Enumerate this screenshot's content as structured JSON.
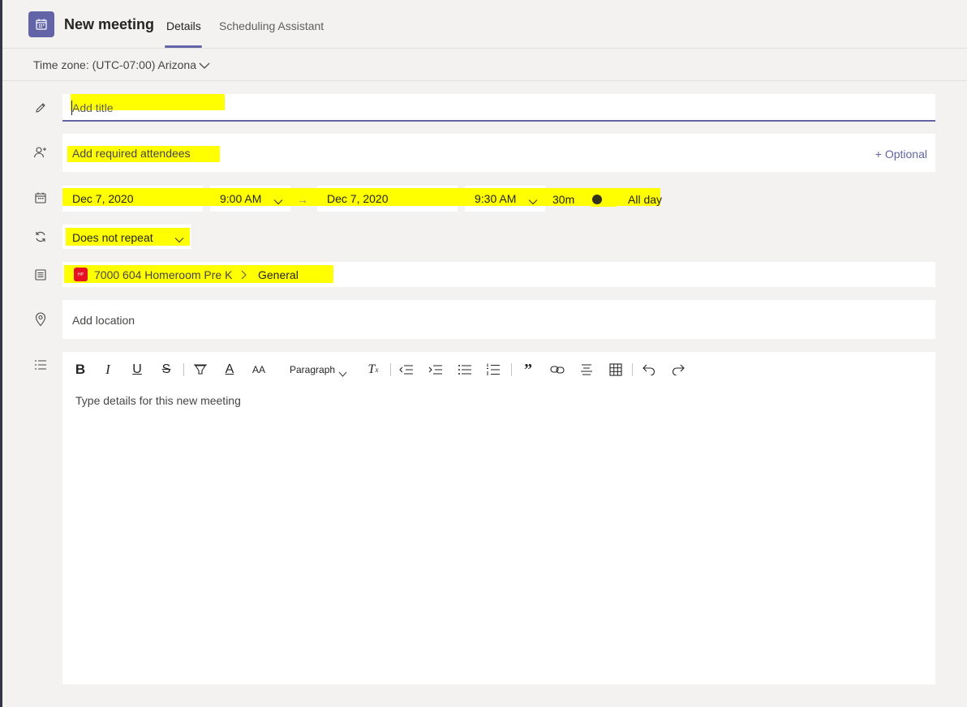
{
  "header": {
    "title": "New meeting",
    "tabs": [
      {
        "label": "Details",
        "active": true
      },
      {
        "label": "Scheduling Assistant",
        "active": false
      }
    ],
    "icon": "calendar-icon",
    "accent": "#6264a7"
  },
  "timezone": {
    "label": "Time zone: (UTC-07:00) Arizona"
  },
  "form": {
    "title_placeholder": "Add title",
    "attendees_placeholder": "Add required attendees",
    "optional_label": "+ Optional",
    "start_date": "Dec 7, 2020",
    "start_time": "9:00 AM",
    "end_date": "Dec 7, 2020",
    "end_time": "9:30 AM",
    "duration": "30m",
    "all_day_label": "All day",
    "all_day_on": false,
    "repeat": "Does not repeat",
    "team_badge": "HP",
    "team_name": "7000 604 Homeroom Pre K",
    "channel": "General",
    "location_placeholder": "Add location"
  },
  "editor": {
    "paragraph_label": "Paragraph",
    "placeholder": "Type details for this new meeting",
    "toolbar": [
      "bold-icon",
      "italic-icon",
      "underline-icon",
      "strikethrough-icon",
      "highlight-icon",
      "font-color-icon",
      "font-size-icon",
      "clear-format-icon",
      "decrease-indent-icon",
      "increase-indent-icon",
      "bulleted-list-icon",
      "numbered-list-icon",
      "quote-icon",
      "link-icon",
      "align-icon",
      "table-icon",
      "undo-icon",
      "redo-icon"
    ]
  },
  "colors": {
    "highlight": "#ffff00",
    "background": "#f3f2f1"
  }
}
